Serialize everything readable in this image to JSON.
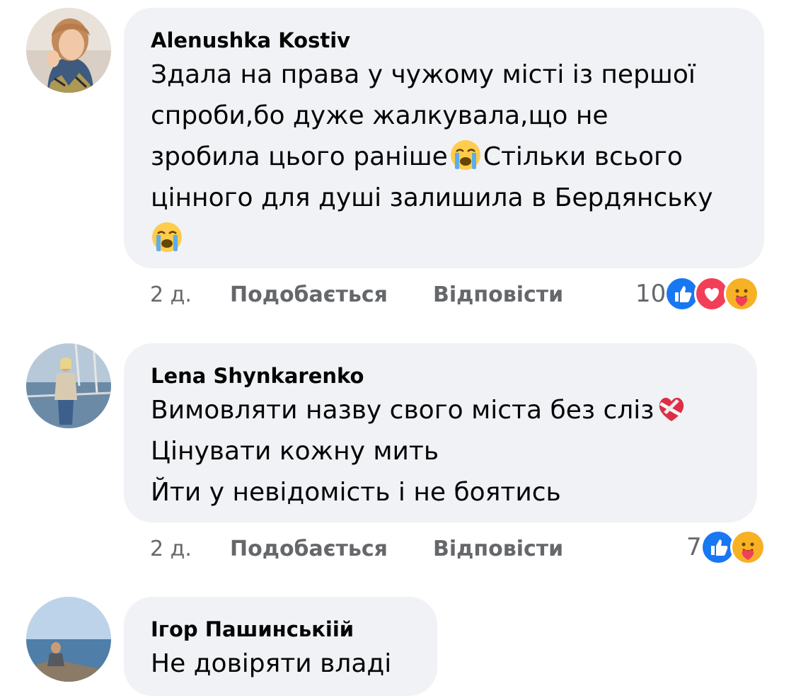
{
  "comments": [
    {
      "author": "Alenushka Kostiv",
      "lines": [
        "Здала на права у чужому місті із першої",
        "спроби,бо дуже жалкувала,що не",
        "зробила цього раніше",
        "Стільки всього",
        "цінного для душі залишила в Бердянську"
      ],
      "time": "2 д.",
      "like_label": "Подобається",
      "reply_label": "Відповісти",
      "reaction_count": "10",
      "reaction_icons": [
        "like-icon",
        "love-icon",
        "care-icon"
      ],
      "emoji": "loudly-crying-face-icon"
    },
    {
      "author": "Lena Shynkarenko",
      "lines": [
        "Вимовляти назву свого міста без сліз",
        "Цінувати кожну мить",
        "Йти у невідомість і не боятись"
      ],
      "time": "2 д.",
      "like_label": "Подобається",
      "reply_label": "Відповісти",
      "reaction_count": "7",
      "reaction_icons": [
        "like-icon",
        "care-icon"
      ],
      "emoji": "mending-heart-icon"
    },
    {
      "author": "Ігор Пашинськіій",
      "lines": [
        "Не довіряти  владі"
      ]
    }
  ],
  "colors": {
    "bubble": "#f0f2f5",
    "secondary_text": "#65676b",
    "like_blue": "#1877f2",
    "love_red": "#f33e58",
    "care_yellow": "#f7b125"
  }
}
